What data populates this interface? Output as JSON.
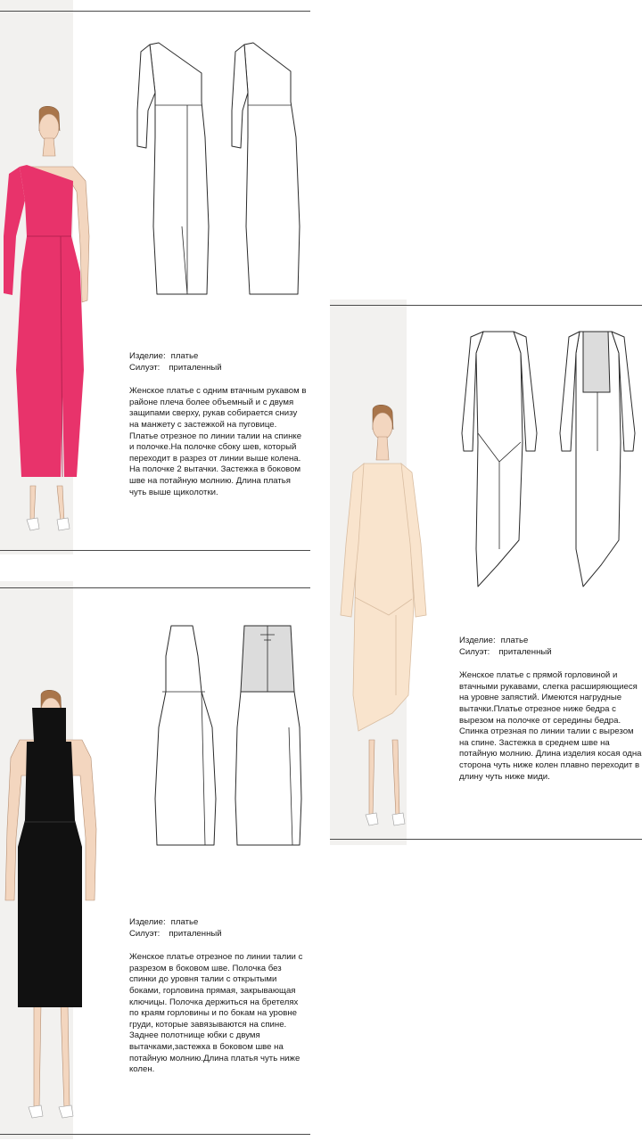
{
  "sheets": [
    {
      "product_label": "Изделие:",
      "product_value": "платье",
      "silhouette_label": "Силуэт:",
      "silhouette_value": "приталенный",
      "description": "Женское платье с одним втачным рукавом в районе плеча более объемный и с двумя защипами сверху, рукав собирается снизу на манжету с застежкой на пуговице. Платье отрезное по линии талии на спинке и полочке.На полочке сбоку шев, который переходит в разрез от линии выше колена. На полочке 2 вытачки. Застежка в боковом шве на потайную молнию. Длина платья чуть выше щиколотки.",
      "dress_color": "#e8336b"
    },
    {
      "product_label": "Изделие:",
      "product_value": "платье",
      "silhouette_label": "Силуэт:",
      "silhouette_value": "приталенный",
      "description": "Женское платье с прямой горловиной и втачными рукавами, слегка расширяющиеся на уровне запястий. Имеются нагрудные вытачки.Платье отрезное ниже бедра с вырезом на полочке от середины бедра. Спинка отрезная по линии талии с вырезом на спине. Застежка в среднем шве на потайную молнию. Длина изделия косая одна сторона чуть ниже колен плавно переходит в длину чуть ниже миди.",
      "dress_color": "#f9e4cd"
    },
    {
      "product_label": "Изделие:",
      "product_value": "платье",
      "silhouette_label": "Силуэт:",
      "silhouette_value": "приталенный",
      "description": "Женское платье отрезное по линии талии с разрезом в боковом шве. Полочка без спинки до уровня талии с открытыми боками, горловина прямая, закрывающая ключицы. Полочка держиться на бретелях по краям горловины и по бокам на уровне груди, которые завязываются на спине. Заднее полотнище юбки с двумя вытачками,застежка в боковом шве на потайную молнию.Длина платья чуть ниже колен.",
      "dress_color": "#111111"
    }
  ]
}
